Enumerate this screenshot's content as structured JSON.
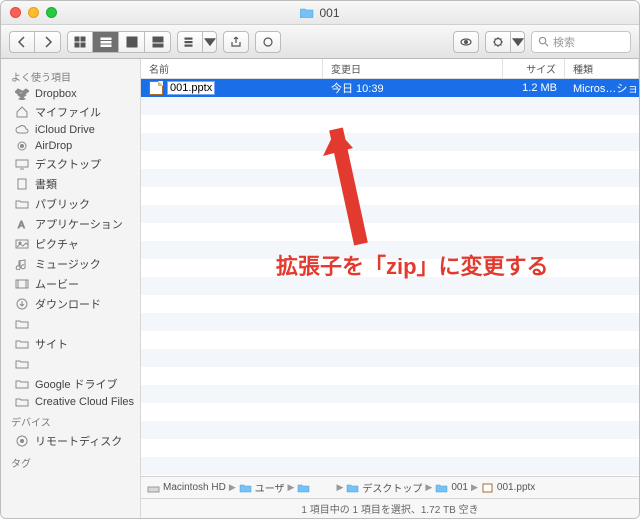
{
  "window_title": "001",
  "toolbar": {
    "search_placeholder": "検索"
  },
  "sidebar": {
    "section_favorites": "よく使う項目",
    "section_devices": "デバイス",
    "section_tags": "タグ",
    "items": [
      {
        "icon": "dropbox",
        "label": "Dropbox"
      },
      {
        "icon": "home",
        "label": "マイファイル"
      },
      {
        "icon": "cloud",
        "label": "iCloud Drive"
      },
      {
        "icon": "airdrop",
        "label": "AirDrop"
      },
      {
        "icon": "desktop",
        "label": "デスクトップ"
      },
      {
        "icon": "doc",
        "label": "書類"
      },
      {
        "icon": "folder",
        "label": "パブリック"
      },
      {
        "icon": "app",
        "label": "アプリケーション"
      },
      {
        "icon": "pic",
        "label": "ピクチャ"
      },
      {
        "icon": "music",
        "label": "ミュージック"
      },
      {
        "icon": "movie",
        "label": "ムービー"
      },
      {
        "icon": "download",
        "label": "ダウンロード"
      },
      {
        "icon": "folder",
        "label": "　　"
      },
      {
        "icon": "folder",
        "label": "サイト"
      },
      {
        "icon": "folder",
        "label": "　　"
      },
      {
        "icon": "folder",
        "label": "Google ドライブ"
      },
      {
        "icon": "folder",
        "label": "Creative Cloud Files"
      }
    ],
    "device_item": {
      "label": "リモートディスク"
    }
  },
  "columns": {
    "name": "名前",
    "date": "変更日",
    "size": "サイズ",
    "kind": "種類"
  },
  "file": {
    "name": "001.pptx",
    "date": "今日 10:39",
    "size": "1.2 MB",
    "kind": "Micros…ション"
  },
  "annotation": "拡張子を「zip」に変更する",
  "pathbar": [
    "Macintosh HD",
    "ユーザ",
    "　　",
    "デスクトップ",
    "001",
    "001.pptx"
  ],
  "statusbar": "1 項目中の 1 項目を選択、1.72 TB 空き"
}
